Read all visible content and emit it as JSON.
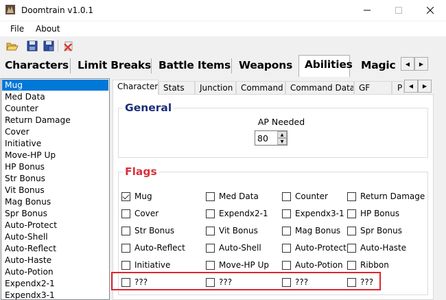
{
  "window": {
    "title": "Doomtrain v1.0.1"
  },
  "menu": {
    "file": "File",
    "about": "About"
  },
  "toolbar": {
    "open": "folder-open-icon",
    "save": "save-icon",
    "save_as": "save-as-icon",
    "close": "close-file-icon"
  },
  "main_tabs": [
    "Characters",
    "Limit Breaks",
    "Battle Items",
    "Weapons",
    "Abilities",
    "Magic"
  ],
  "abilities_list": [
    "Mug",
    "Med Data",
    "Counter",
    "Return Damage",
    "Cover",
    "Initiative",
    "Move-HP Up",
    "HP Bonus",
    "Str Bonus",
    "Vit Bonus",
    "Mag Bonus",
    "Spr Bonus",
    "Auto-Protect",
    "Auto-Shell",
    "Auto-Reflect",
    "Auto-Haste",
    "Auto-Potion",
    "Expendx2-1",
    "Expendx3-1"
  ],
  "sub_tabs": [
    "Character",
    "Stats",
    "Junction",
    "Command",
    "Command Data",
    "GF",
    "P"
  ],
  "general": {
    "title": "General",
    "ap_label": "AP Needed",
    "ap_value": "80"
  },
  "flags": {
    "title": "Flags",
    "rows": [
      [
        {
          "label": "Mug",
          "checked": true
        },
        {
          "label": "Med Data",
          "checked": false
        },
        {
          "label": "Counter",
          "checked": false
        },
        {
          "label": "Return Damage",
          "checked": false
        }
      ],
      [
        {
          "label": "Cover",
          "checked": false
        },
        {
          "label": "Expendx2-1",
          "checked": false
        },
        {
          "label": "Expendx3-1",
          "checked": false
        },
        {
          "label": "HP Bonus",
          "checked": false
        }
      ],
      [
        {
          "label": "Str Bonus",
          "checked": false
        },
        {
          "label": "Vit Bonus",
          "checked": false
        },
        {
          "label": "Mag Bonus",
          "checked": false
        },
        {
          "label": "Spr Bonus",
          "checked": false
        }
      ],
      [
        {
          "label": "Auto-Reflect",
          "checked": false
        },
        {
          "label": "Auto-Shell",
          "checked": false
        },
        {
          "label": "Auto-Protect",
          "checked": false
        },
        {
          "label": "Auto-Haste",
          "checked": false
        }
      ],
      [
        {
          "label": "Initiative",
          "checked": false
        },
        {
          "label": "Move-HP Up",
          "checked": false
        },
        {
          "label": "Auto-Potion",
          "checked": false
        },
        {
          "label": "Ribbon",
          "checked": false
        }
      ],
      [
        {
          "label": "???",
          "checked": false
        },
        {
          "label": "???",
          "checked": false
        },
        {
          "label": "???",
          "checked": false
        },
        {
          "label": "???",
          "checked": false
        }
      ]
    ]
  },
  "colors": {
    "accent": "#0078d7",
    "general_title": "#1c2e79",
    "flags_title": "#d9303c",
    "highlight": "#e0242c"
  }
}
